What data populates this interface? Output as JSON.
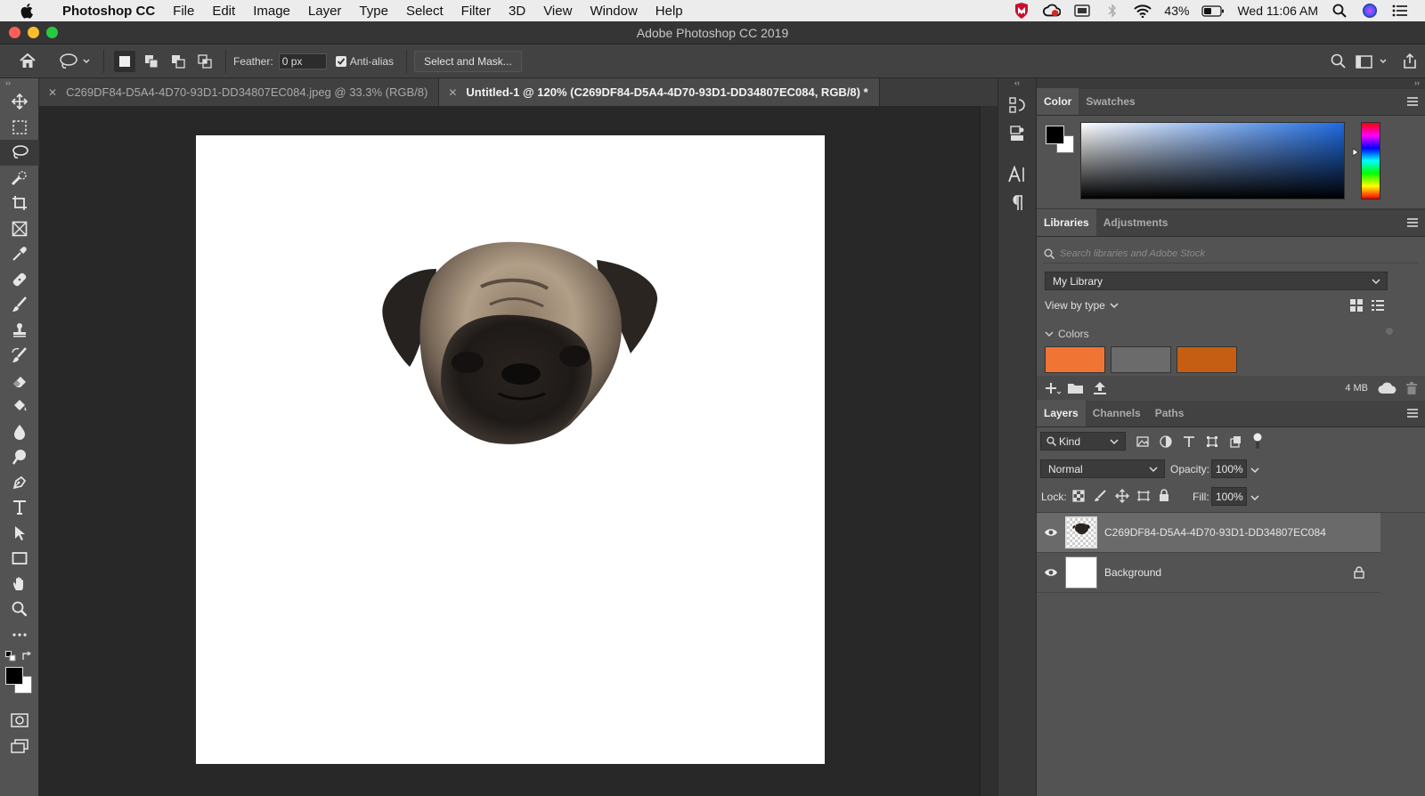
{
  "menubar": {
    "app": "Photoshop CC",
    "items": [
      "File",
      "Edit",
      "Image",
      "Layer",
      "Type",
      "Select",
      "Filter",
      "3D",
      "View",
      "Window",
      "Help"
    ],
    "battery": "43%",
    "clock": "Wed 11:06 AM"
  },
  "window": {
    "title": "Adobe Photoshop CC 2019"
  },
  "options": {
    "feather_label": "Feather:",
    "feather_value": "0 px",
    "antialias_label": "Anti-alias",
    "antialias_checked": true,
    "select_mask_label": "Select and Mask..."
  },
  "tabs": [
    {
      "label": "C269DF84-D5A4-4D70-93D1-DD34807EC084.jpeg @ 33.3% (RGB/8)",
      "active": false
    },
    {
      "label": "Untitled-1 @ 120% (C269DF84-D5A4-4D70-93D1-DD34807EC084, RGB/8) *",
      "active": true
    }
  ],
  "tools": [
    "move-tool-icon",
    "marquee-tool-icon",
    "lasso-tool-icon",
    "quick-select-tool-icon",
    "crop-tool-icon",
    "frame-tool-icon",
    "eyedropper-tool-icon",
    "healing-tool-icon",
    "brush-tool-icon",
    "stamp-tool-icon",
    "history-brush-tool-icon",
    "eraser-tool-icon",
    "paint-bucket-tool-icon",
    "blur-tool-icon",
    "dodge-tool-icon",
    "pen-tool-icon",
    "type-tool-icon",
    "path-select-tool-icon",
    "rectangle-tool-icon",
    "hand-tool-icon",
    "zoom-tool-icon",
    "more-tools-icon"
  ],
  "color_panel": {
    "tabs": [
      "Color",
      "Swatches"
    ],
    "foreground": "#000000",
    "background": "#ffffff",
    "hue_base": "#1f6be0"
  },
  "libraries": {
    "tabs": [
      "Libraries",
      "Adjustments"
    ],
    "search_placeholder": "Search libraries and Adobe Stock",
    "library": "My Library",
    "view_by": "View by type",
    "colors_label": "Colors",
    "swatches": [
      "#f07434",
      "#6b6b6b",
      "#c55e12"
    ],
    "storage": "4 MB"
  },
  "layers": {
    "tabs": [
      "Layers",
      "Channels",
      "Paths"
    ],
    "filter_kind": "Kind",
    "blend_mode": "Normal",
    "opacity_label": "Opacity:",
    "opacity": "100%",
    "lock_label": "Lock:",
    "fill_label": "Fill:",
    "fill": "100%",
    "items": [
      {
        "name": "C269DF84-D5A4-4D70-93D1-DD34807EC084",
        "selected": true,
        "locked": false
      },
      {
        "name": "Background",
        "selected": false,
        "locked": true
      }
    ]
  }
}
